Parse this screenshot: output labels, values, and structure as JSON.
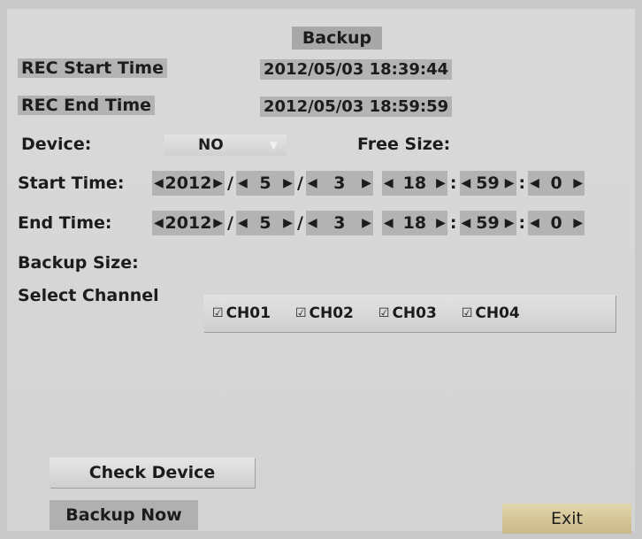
{
  "title": "Backup",
  "rec_start": {
    "label": "REC Start Time",
    "value": "2012/05/03 18:39:44"
  },
  "rec_end": {
    "label": "REC End Time",
    "value": "2012/05/03 18:59:59"
  },
  "device": {
    "label": "Device:",
    "value": "NO",
    "free_size_label": "Free Size:"
  },
  "start_time": {
    "label": "Start Time:",
    "year": "2012",
    "month": "5",
    "day": "3",
    "hour": "18",
    "minute": "59",
    "second": "0"
  },
  "end_time": {
    "label": "End Time:",
    "year": "2012",
    "month": "5",
    "day": "3",
    "hour": "18",
    "minute": "59",
    "second": "0"
  },
  "backup_size_label": "Backup Size:",
  "select_channel_label": "Select Channel",
  "channels": [
    {
      "label": "CH01",
      "checked": true
    },
    {
      "label": "CH02",
      "checked": true
    },
    {
      "label": "CH03",
      "checked": true
    },
    {
      "label": "CH04",
      "checked": true
    }
  ],
  "buttons": {
    "check_device": "Check Device",
    "backup_now": "Backup Now",
    "exit": "Exit"
  },
  "separators": {
    "date": "/",
    "time": ":"
  }
}
